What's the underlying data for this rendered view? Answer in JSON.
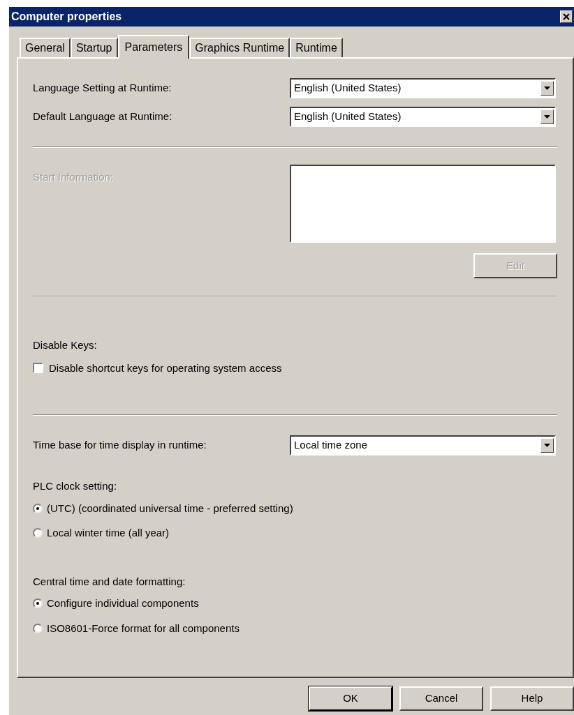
{
  "window": {
    "title": "Computer properties"
  },
  "tabs": [
    {
      "label": "General",
      "selected": false
    },
    {
      "label": "Startup",
      "selected": false
    },
    {
      "label": "Parameters",
      "selected": true
    },
    {
      "label": "Graphics Runtime",
      "selected": false
    },
    {
      "label": "Runtime",
      "selected": false
    }
  ],
  "language": [
    {
      "label": "Language Setting at Runtime:",
      "value": "English (United States)"
    },
    {
      "label": "Default Language at Runtime:",
      "value": "English (United States)"
    }
  ],
  "start_information": {
    "label": "Start Information:",
    "disabled": true,
    "edit_button": {
      "label": "Edit",
      "disabled": true
    }
  },
  "disable_keys": {
    "title": "Disable Keys:",
    "checkbox": {
      "label": "Disable shortcut keys for operating system access",
      "checked": false
    }
  },
  "time_base": {
    "label": "Time base for time display in runtime:",
    "value": "Local time zone"
  },
  "plc_clock": {
    "title": "PLC clock setting:",
    "options": [
      {
        "label": "(UTC) (coordinated universal time - preferred setting)",
        "selected": true
      },
      {
        "label": "Local winter time (all year)",
        "selected": false
      }
    ]
  },
  "date_formatting": {
    "title": "Central time and date formatting:",
    "options": [
      {
        "label": "Configure individual components",
        "selected": true
      },
      {
        "label": "ISO8601-Force format for all components",
        "selected": false
      }
    ]
  },
  "buttons": [
    {
      "label": "OK",
      "default": true
    },
    {
      "label": "Cancel",
      "default": false
    },
    {
      "label": "Help",
      "default": false
    }
  ]
}
